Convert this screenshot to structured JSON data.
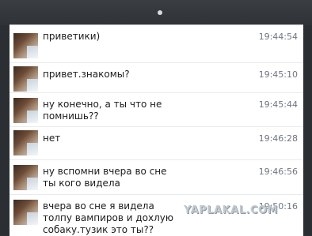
{
  "messages": [
    {
      "text": "приветики)",
      "time": "19:44:54"
    },
    {
      "text": "привет.знакомы?",
      "time": "19:45:10"
    },
    {
      "text": "ну конечно, а ты что не помнишь??",
      "time": "19:45:44"
    },
    {
      "text": "нет",
      "time": "19:46:28"
    },
    {
      "text": "ну вспомни вчера во сне ты кого видела",
      "time": "19:46:56"
    },
    {
      "text": "вчера во сне я видела толпу вампиров и дохлую собаку.тузик это ты??",
      "time": "19:50:16"
    }
  ],
  "watermark": "YAPLAKAL.COM"
}
